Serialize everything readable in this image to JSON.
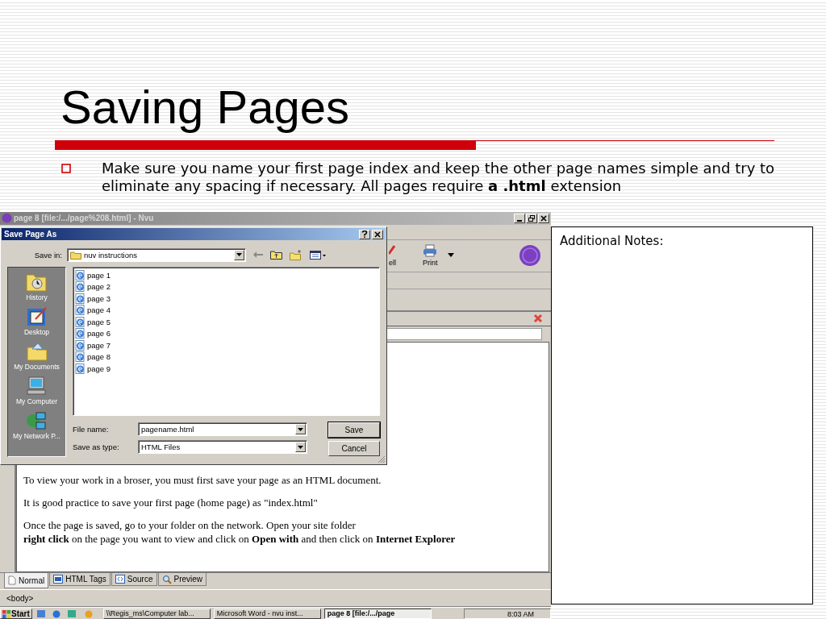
{
  "slide": {
    "title": "Saving Pages",
    "bullets": [
      "Make sure you name your first page index and keep the other page names simple and try to eliminate any spacing if necessary.  All pages require **a .html** extension"
    ]
  },
  "editor_window": {
    "title": "page 8 [file:/.../page%208.html] - Nvu",
    "toolbar": [
      {
        "kind": "spell",
        "label": "ell"
      },
      {
        "kind": "print",
        "label": "Print"
      }
    ],
    "content": [
      "To view your work in a broser, you must first save your page as an HTML document.",
      "It is good practice to save your first page (home page) as \"index.html\"",
      "Once the page is saved, go to your folder on the network.  Open your site folder",
      "**right click** on the page you want to view and click on **Open with** and then click on **Internet Explorer**"
    ],
    "view_tabs": [
      {
        "kind": "normal",
        "label": "Normal",
        "selected": true
      },
      {
        "kind": "tags",
        "label": "HTML Tags",
        "selected": false
      },
      {
        "kind": "source",
        "label": "Source",
        "selected": false
      },
      {
        "kind": "preview",
        "label": "Preview",
        "selected": false
      }
    ],
    "status": "<body>"
  },
  "dialog": {
    "title": "Save Page As",
    "save_in_label": "Save in:",
    "save_in_value": "nuv instructions",
    "places": [
      {
        "kind": "history",
        "label": "History"
      },
      {
        "kind": "desktop",
        "label": "Desktop"
      },
      {
        "kind": "documents",
        "label": "My Documents"
      },
      {
        "kind": "computer",
        "label": "My Computer"
      },
      {
        "kind": "network",
        "label": "My Network P..."
      }
    ],
    "files": [
      "page 1",
      "page 2",
      "page 3",
      "page 4",
      "page 5",
      "page 6",
      "page 7",
      "page 8",
      "page 9"
    ],
    "file_name_label": "File name:",
    "file_name": "pagename.html",
    "type_label": "Save as type:",
    "type_value": "HTML Files",
    "buttons": [
      "Save",
      "Cancel"
    ]
  },
  "taskbar": {
    "start": "Start",
    "tasks": [
      {
        "label": "\\\\Regis_ms\\Computer lab...",
        "selected": false
      },
      {
        "label": "Microsoft Word - nvu inst...",
        "selected": false
      },
      {
        "label": "page 8 [file:/.../page",
        "selected": true
      }
    ],
    "clock": "8:03 AM"
  },
  "notes": {
    "label": "Additional Notes:"
  }
}
